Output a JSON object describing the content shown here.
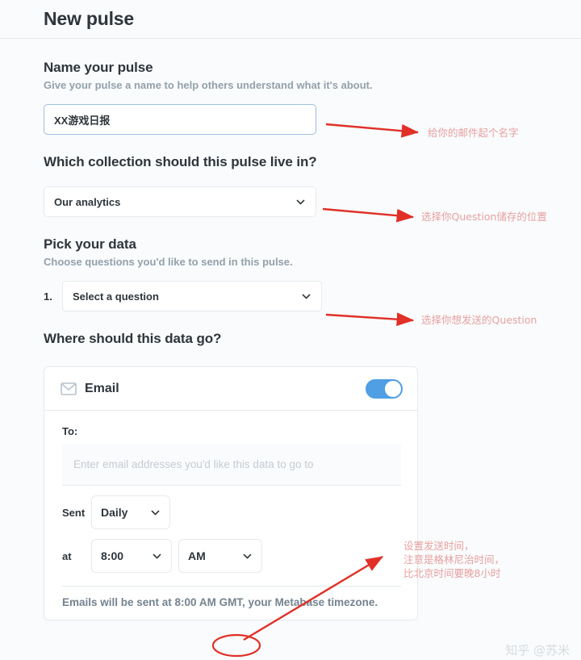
{
  "header": {
    "title": "New pulse"
  },
  "sections": {
    "name": {
      "title": "Name your pulse",
      "subtitle": "Give your pulse a name to help others understand what it's about.",
      "input_value": "XX游戏日报"
    },
    "collection": {
      "title": "Which collection should this pulse live in?",
      "selected": "Our analytics"
    },
    "data": {
      "title": "Pick your data",
      "subtitle": "Choose questions you'd like to send in this pulse.",
      "rows": [
        {
          "number": "1.",
          "placeholder": "Select a question"
        }
      ]
    },
    "destination": {
      "title": "Where should this data go?",
      "channel": {
        "name": "Email",
        "icon": "envelope-icon",
        "enabled": true,
        "toggle_color": "#509ee3",
        "to_label": "To:",
        "recipients_placeholder": "Enter email addresses you'd like this data to go to",
        "schedule": {
          "sent_label": "Sent",
          "frequency": "Daily",
          "at_label": "at",
          "time": "8:00",
          "meridiem": "AM"
        },
        "timezone_note": "Emails will be sent at 8:00 AM GMT, your Metabase timezone."
      }
    }
  },
  "annotations": {
    "color": "#e8a0a0",
    "arrow_color": "#e03027",
    "items": [
      {
        "text": "给你的邮件起个名字"
      },
      {
        "text": "选择你Question储存的位置"
      },
      {
        "text": "选择你想发送的Question"
      },
      {
        "text": "设置发送时间，\n注意是格林尼治时间，\n比北京时间要晚8小时"
      }
    ]
  },
  "watermark": {
    "text": "知乎 @苏米"
  }
}
